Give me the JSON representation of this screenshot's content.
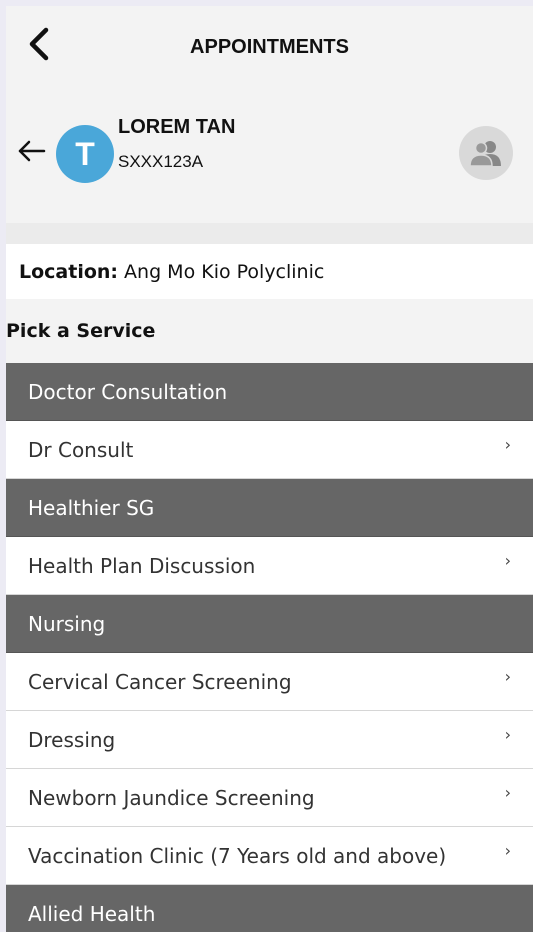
{
  "header": {
    "title": "APPOINTMENTS"
  },
  "patient": {
    "initial": "T",
    "name": "LOREM TAN",
    "id": "SXXX123A"
  },
  "location": {
    "label": "Location:",
    "value": "Ang Mo Kio Polyclinic"
  },
  "pick_title": "Pick a Service",
  "sections": [
    {
      "category": "Doctor Consultation",
      "items": [
        "Dr Consult"
      ]
    },
    {
      "category": "Healthier SG",
      "items": [
        "Health Plan Discussion"
      ]
    },
    {
      "category": "Nursing",
      "items": [
        "Cervical Cancer Screening",
        "Dressing",
        "Newborn Jaundice Screening",
        "Vaccination Clinic (7 Years old and above)"
      ]
    },
    {
      "category": "Allied Health",
      "items": []
    }
  ],
  "chevron": "›",
  "colors": {
    "avatar": "#4aa7d9",
    "category_bg": "#666666"
  },
  "icons": {
    "back": "chevron-left-icon",
    "arrow": "arrow-left-icon",
    "switch_user": "users-icon"
  }
}
